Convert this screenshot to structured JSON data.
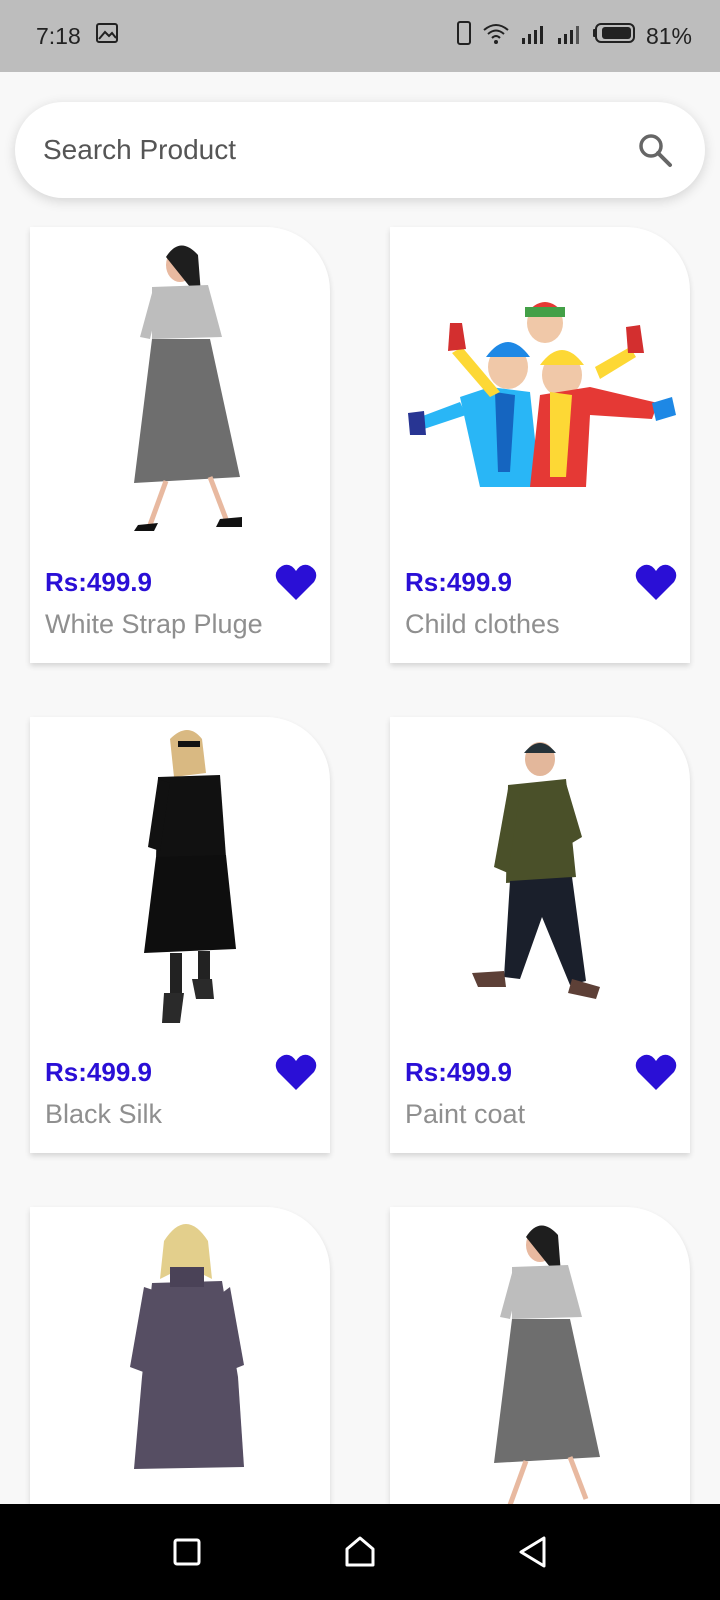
{
  "status_bar": {
    "time": "7:18",
    "battery": "81%",
    "icons": [
      "gallery-icon",
      "vibrate-icon",
      "wifi-icon",
      "signal-icon",
      "signal-icon",
      "battery-icon"
    ]
  },
  "search": {
    "placeholder": "Search Product",
    "icon": "search-icon"
  },
  "products": [
    {
      "price": "Rs:499.9",
      "name": "White Strap Pluge",
      "image": "woman-grey-dress",
      "favorite": true
    },
    {
      "price": "Rs:499.9",
      "name": "Child clothes",
      "image": "kids-winter-clothes",
      "favorite": true
    },
    {
      "price": "Rs:499.9",
      "name": "Black Silk",
      "image": "woman-black-dress",
      "favorite": true
    },
    {
      "price": "Rs:499.9",
      "name": "Paint coat",
      "image": "man-green-coat",
      "favorite": true
    },
    {
      "price": "",
      "name": "",
      "image": "woman-purple-dress",
      "favorite": false
    },
    {
      "price": "",
      "name": "",
      "image": "woman-grey-dress",
      "favorite": false
    }
  ],
  "colors": {
    "accent": "#2a0fd6",
    "price": "#2a0fd6",
    "name": "#8f8f8f",
    "status_bar": "#bdbdbd",
    "nav_bar": "#000000"
  },
  "nav": {
    "icons": [
      "recent-apps-icon",
      "home-icon",
      "back-icon"
    ]
  }
}
